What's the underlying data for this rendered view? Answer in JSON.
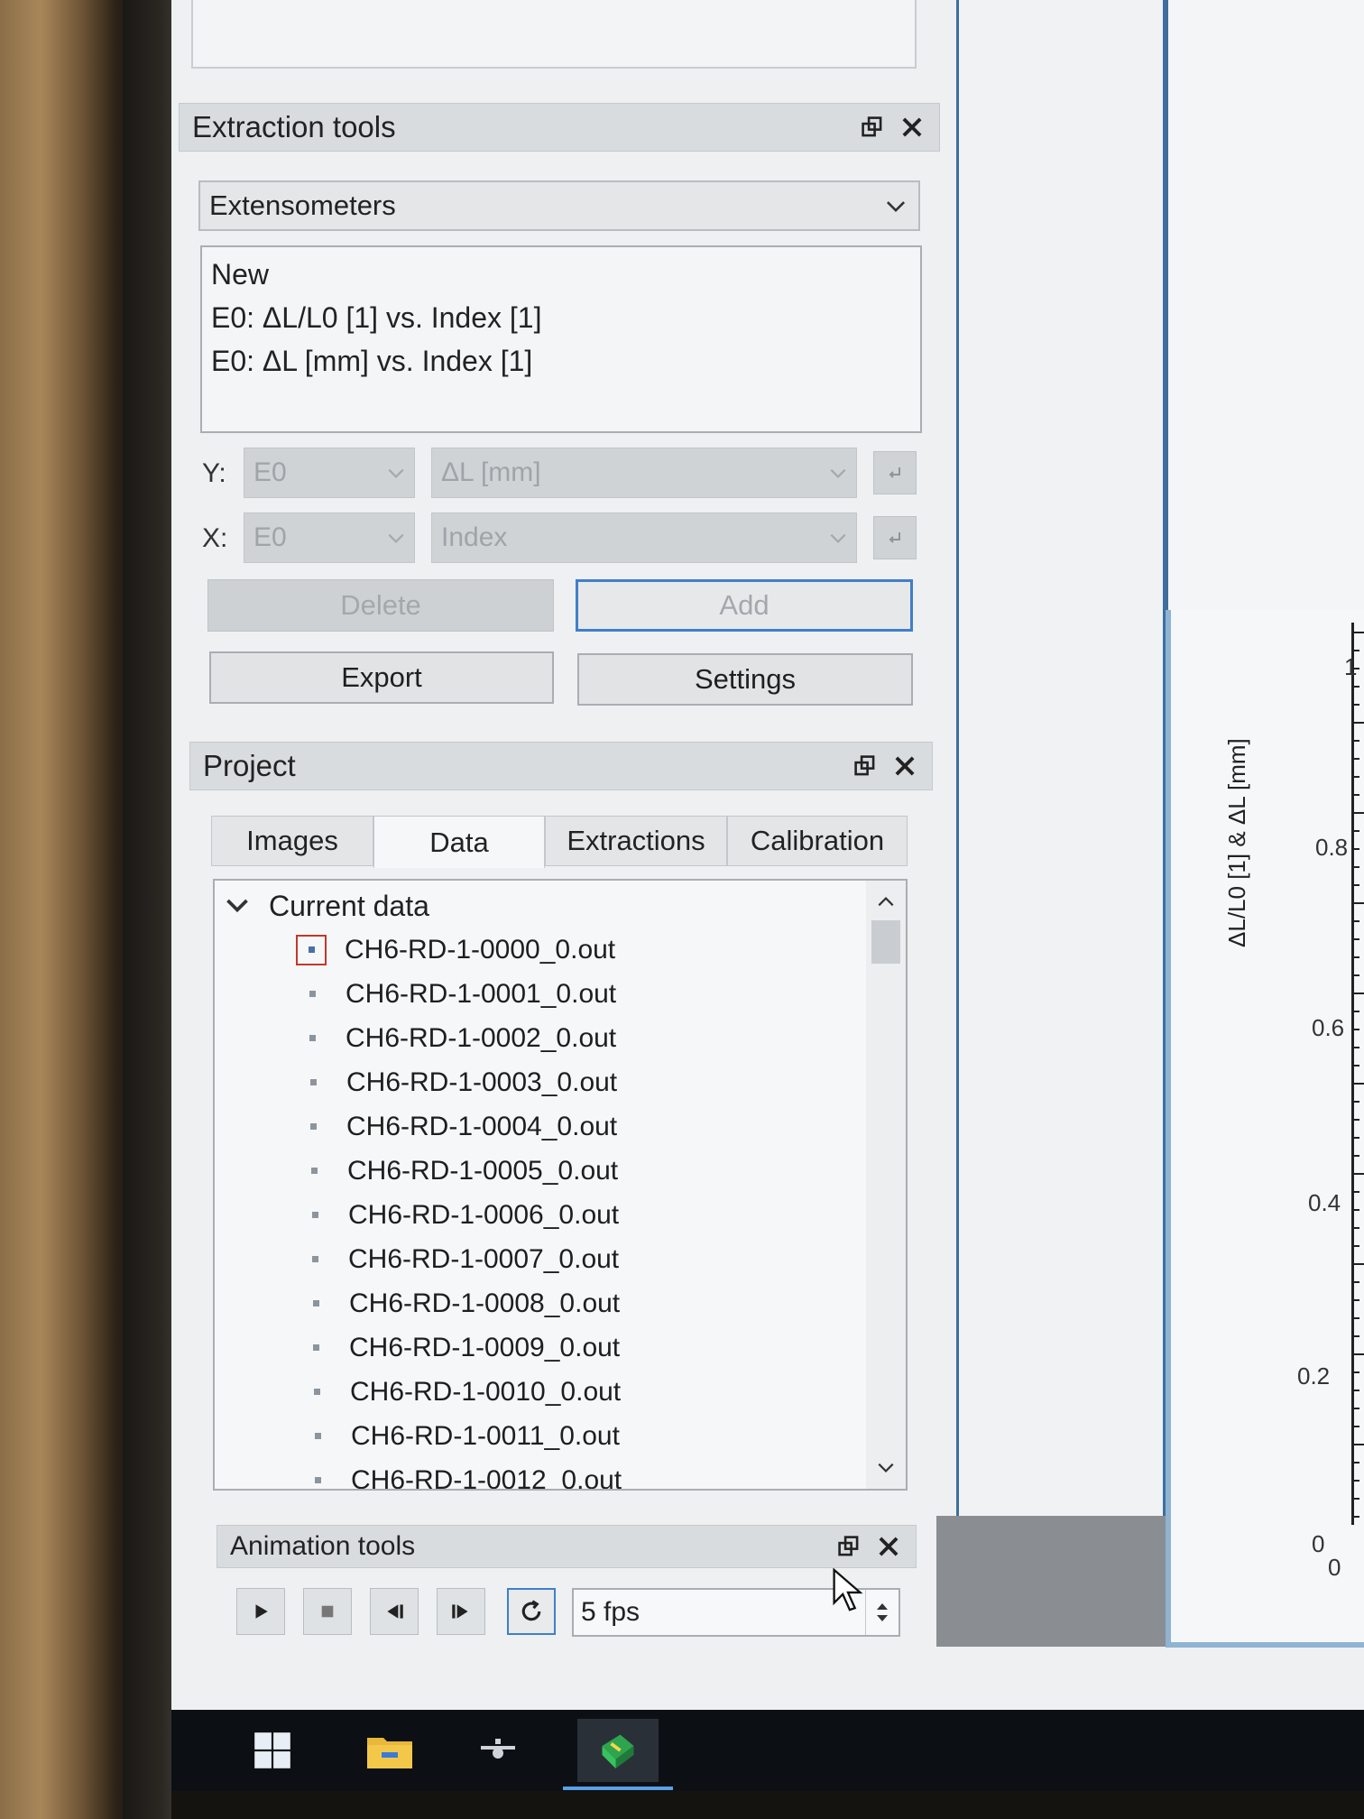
{
  "extraction_tools": {
    "title": "Extraction tools",
    "tool_type": "Extensometers",
    "list_items": [
      "New",
      "E0: ΔL/L0 [1] vs. Index [1]",
      "E0: ΔL [mm] vs. Index [1]"
    ],
    "y_label": "Y:",
    "y_source": "E0",
    "y_quantity": "ΔL [mm]",
    "x_label": "X:",
    "x_source": "E0",
    "x_quantity": "Index",
    "delete_label": "Delete",
    "add_label": "Add",
    "export_label": "Export",
    "settings_label": "Settings"
  },
  "project": {
    "title": "Project",
    "tabs": [
      "Images",
      "Data",
      "Extractions",
      "Calibration"
    ],
    "active_tab": "Data",
    "tree_root": "Current data",
    "files": [
      "CH6-RD-1-0000_0.out",
      "CH6-RD-1-0001_0.out",
      "CH6-RD-1-0002_0.out",
      "CH6-RD-1-0003_0.out",
      "CH6-RD-1-0004_0.out",
      "CH6-RD-1-0005_0.out",
      "CH6-RD-1-0006_0.out",
      "CH6-RD-1-0007_0.out",
      "CH6-RD-1-0008_0.out",
      "CH6-RD-1-0009_0.out",
      "CH6-RD-1-0010_0.out",
      "CH6-RD-1-0011_0.out",
      "CH6-RD-1-0012_0.out"
    ],
    "selected_index": 0
  },
  "animation_tools": {
    "title": "Animation tools",
    "fps": "5 fps"
  },
  "plot": {
    "y_axis_label": "ΔL/L0 [1] & ΔL [mm]",
    "y_ticks": [
      "1",
      "0.8",
      "0.6",
      "0.4",
      "0.2",
      "0"
    ],
    "x_tick_first": "0"
  },
  "colors": {
    "accent": "#3f7fc9",
    "selection_border": "#c0392b",
    "panel_border": "#3d6f9f"
  },
  "icons": {
    "taskbar": [
      "windows-start-icon",
      "file-explorer-icon",
      "camera-app-icon",
      "analysis-app-icon"
    ]
  }
}
